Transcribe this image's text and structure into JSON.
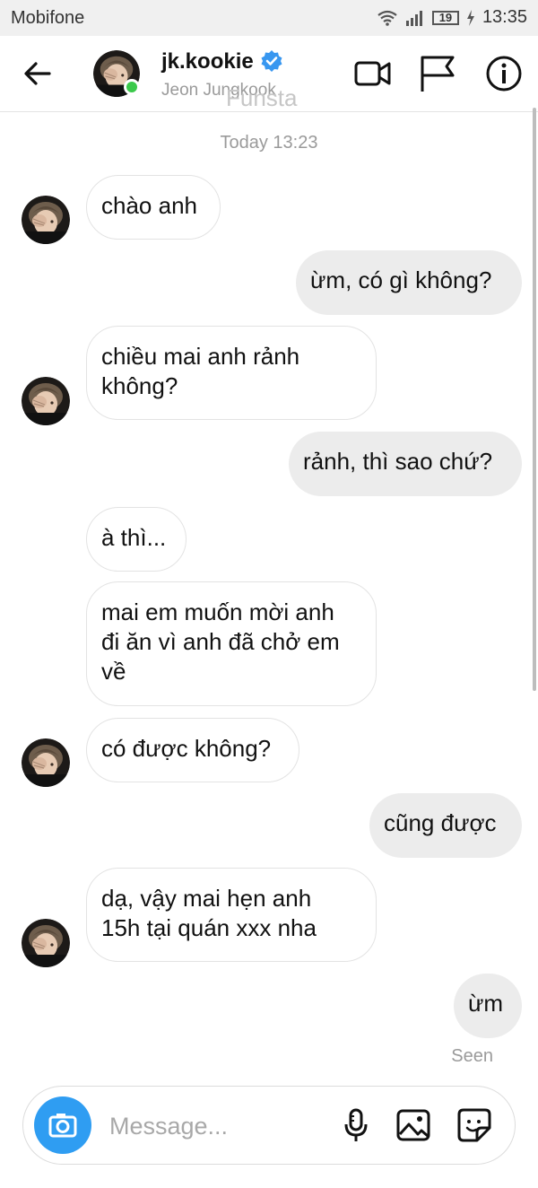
{
  "status_bar": {
    "carrier": "Mobifone",
    "battery": "19",
    "time": "13:35"
  },
  "header": {
    "username": "jk.kookie",
    "display_name": "Jeon Jungkook",
    "watermark": "Funsta"
  },
  "thread": {
    "timestamp": "Today 13:23",
    "messages": [
      {
        "from": "them",
        "text": "chào anh"
      },
      {
        "from": "me",
        "text": "ừm, có gì không?"
      },
      {
        "from": "them",
        "text": "chiều mai anh rảnh\nkhông?"
      },
      {
        "from": "me",
        "text": "rảnh, thì sao chứ?"
      },
      {
        "from": "them",
        "text": "à thì..."
      },
      {
        "from": "them",
        "text": "mai em muốn mời anh\nđi ăn vì anh đã chở em\nvề"
      },
      {
        "from": "them",
        "text": "có được không?"
      },
      {
        "from": "me",
        "text": "cũng được"
      },
      {
        "from": "them",
        "text": "dạ, vậy mai hẹn anh\n15h tại quán xxx nha"
      },
      {
        "from": "me",
        "text": "ừm"
      }
    ],
    "seen_label": "Seen"
  },
  "composer": {
    "placeholder": "Message..."
  },
  "colors": {
    "accent": "#3897f0",
    "online": "#3bc94b",
    "camera": "#2f9df2",
    "bubble_out": "#ececec"
  },
  "icons": [
    "back-arrow-icon",
    "verified-badge-icon",
    "video-call-icon",
    "flag-icon",
    "info-icon",
    "camera-icon",
    "microphone-icon",
    "gallery-icon",
    "sticker-icon"
  ]
}
